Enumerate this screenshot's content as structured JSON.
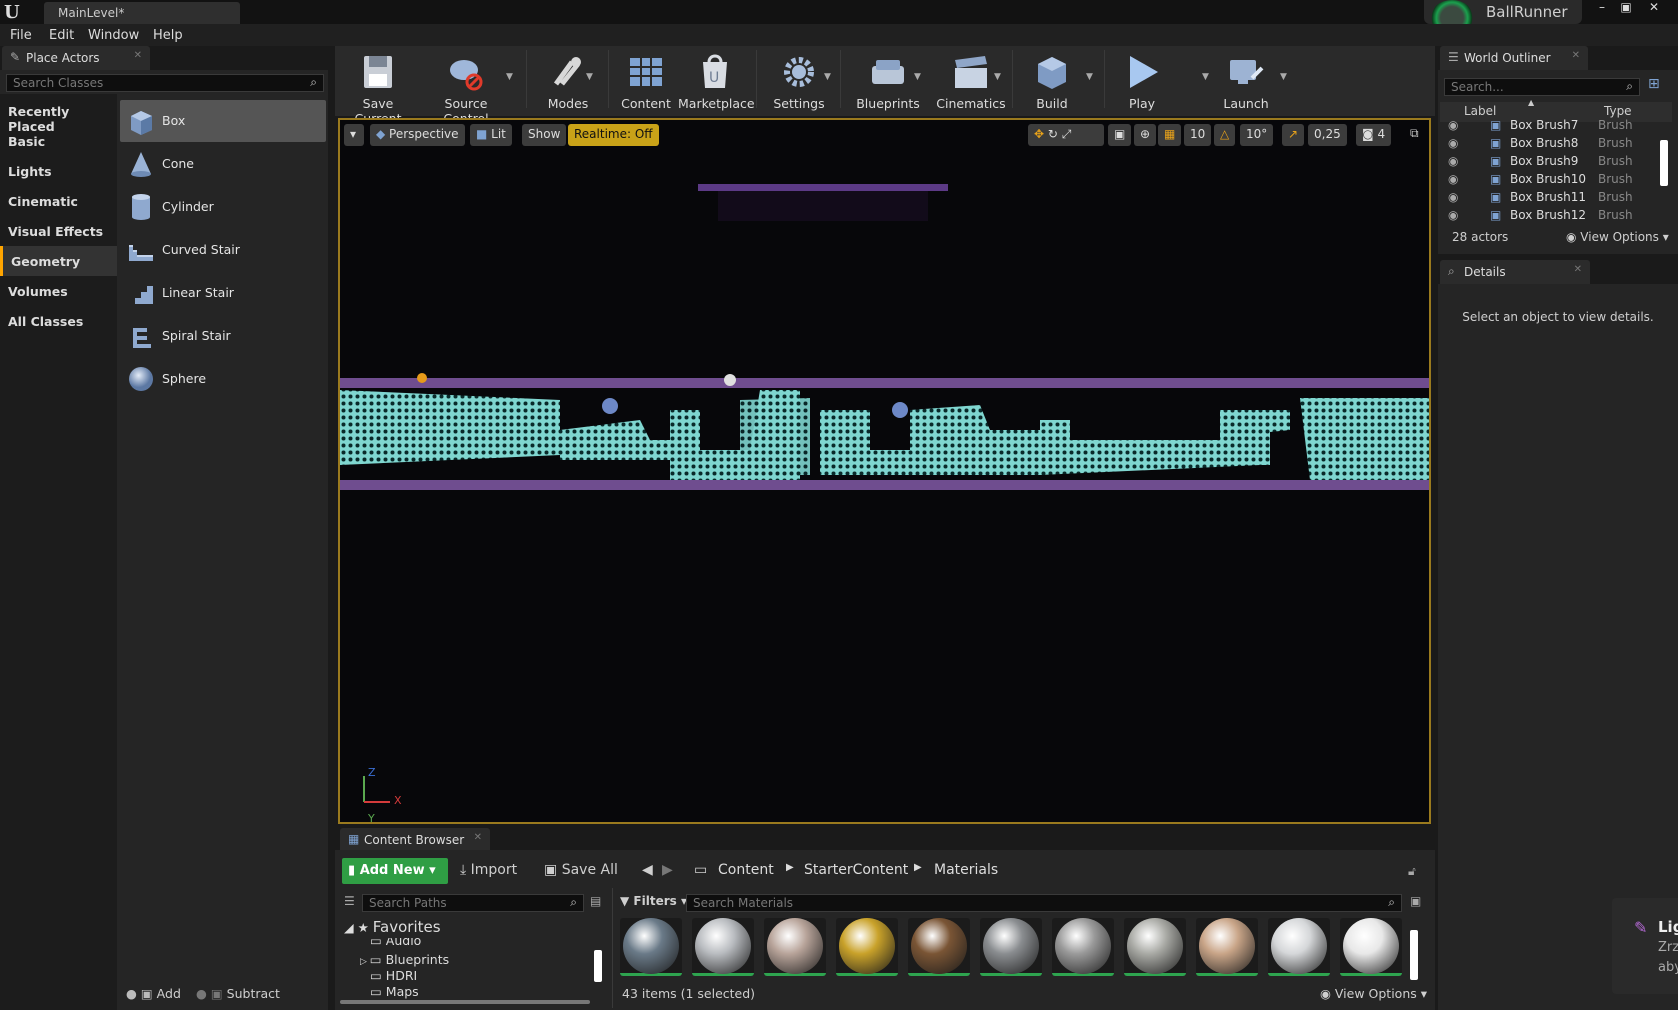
{
  "window": {
    "tab": "MainLevel*",
    "project": "BallRunner",
    "controls": [
      "–",
      "▣",
      "✕"
    ]
  },
  "menu": [
    "File",
    "Edit",
    "Window",
    "Help"
  ],
  "place_actors": {
    "tab_label": "Place Actors",
    "search_placeholder": "Search Classes",
    "categories": [
      "Recently Placed",
      "Basic",
      "Lights",
      "Cinematic",
      "Visual Effects",
      "Geometry",
      "Volumes",
      "All Classes"
    ],
    "selected_category": "Geometry",
    "actors": [
      "Box",
      "Cone",
      "Cylinder",
      "Curved Stair",
      "Linear Stair",
      "Spiral Stair",
      "Sphere"
    ],
    "selected_actor": "Box",
    "mode_add": "Add",
    "mode_subtract": "Subtract"
  },
  "toolbar": [
    "Save Current",
    "Source Control",
    "Modes",
    "Content",
    "Marketplace",
    "Settings",
    "Blueprints",
    "Cinematics",
    "Build",
    "Play",
    "Launch"
  ],
  "viewport": {
    "perspective": "Perspective",
    "lit": "Lit",
    "show": "Show",
    "realtime": "Realtime: Off",
    "grid_snap": "10",
    "rot_snap": "10°",
    "scale_snap": "0,25",
    "cam_speed": "4",
    "axis_x": "X",
    "axis_y": "Y",
    "axis_z": "Z"
  },
  "outliner": {
    "tab_label": "World Outliner",
    "search_placeholder": "Search...",
    "col_label": "Label",
    "col_type": "Type",
    "rows": [
      {
        "label": "Box Brush7",
        "type": "Brush"
      },
      {
        "label": "Box Brush8",
        "type": "Brush"
      },
      {
        "label": "Box Brush9",
        "type": "Brush"
      },
      {
        "label": "Box Brush10",
        "type": "Brush"
      },
      {
        "label": "Box Brush11",
        "type": "Brush"
      },
      {
        "label": "Box Brush12",
        "type": "Brush"
      }
    ],
    "count": "28 actors",
    "view_options": "View Options"
  },
  "details": {
    "tab_label": "Details",
    "empty": "Select an object to view details."
  },
  "content_browser": {
    "tab_label": "Content Browser",
    "add_new": "Add New",
    "import": "Import",
    "save_all": "Save All",
    "path": [
      "Content",
      "StarterContent",
      "Materials"
    ],
    "search_paths": "Search Paths",
    "filters": "Filters",
    "search_materials": "Search Materials",
    "favorites": "Favorites",
    "folders": [
      "Audio",
      "Blueprints",
      "HDRI",
      "Maps"
    ],
    "status": "43 items (1 selected)",
    "view_options": "View Options",
    "material_colors": [
      "#6a7a88",
      "#b9bcc0",
      "#b8a49a",
      "#c9a22a",
      "#7a5535",
      "#8a8d90",
      "#9a9a9a",
      "#a9aaa5",
      "#c9a588",
      "#d5d7d9",
      "#e8e8e8"
    ]
  },
  "notification": {
    "title": "Lig",
    "line1": "Zrz",
    "line2": "aby"
  }
}
